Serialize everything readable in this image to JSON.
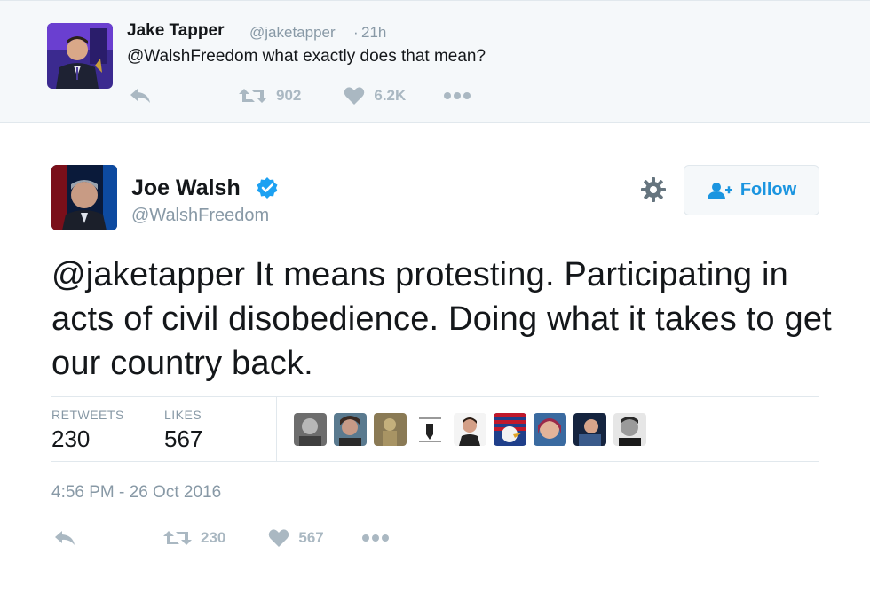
{
  "parent_tweet": {
    "name": "Jake Tapper",
    "handle": "@jaketapper",
    "separator": "·",
    "time": "21h",
    "text": "@WalshFreedom what exactly does that mean?",
    "retweets": "902",
    "likes": "6.2K",
    "icons": [
      "reply-icon",
      "retweet-icon",
      "heart-icon",
      "more-icon"
    ]
  },
  "tweet": {
    "name": "Joe Walsh",
    "handle": "@WalshFreedom",
    "follow_label": "Follow",
    "mention": "@jaketapper",
    "text": " It means protesting. Participating in acts of civil disobedience. Doing what it takes to get our country back.",
    "stats": {
      "retweets_label": "RETWEETS",
      "retweets_value": "230",
      "likes_label": "LIKES",
      "likes_value": "567"
    },
    "timestamp": "4:56 PM - 26 Oct 2016",
    "action_retweets": "230",
    "action_likes": "567"
  },
  "colors": {
    "accent": "#1b95e0",
    "muted": "#8899a6",
    "icon": "#aab8c2",
    "verified": "#1da1f2"
  }
}
